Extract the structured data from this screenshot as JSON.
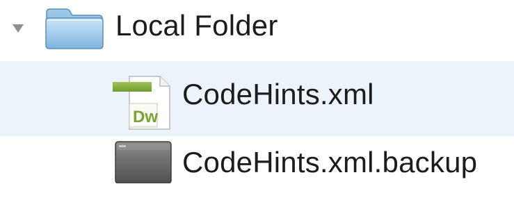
{
  "tree": {
    "folder": {
      "label": "Local Folder",
      "expanded": true,
      "disclosure_icon": "triangle-down-icon",
      "icon": "folder-icon"
    },
    "items": [
      {
        "label": "CodeHints.xml",
        "icon": "dreamweaver-file-icon",
        "icon_badge": "Dw",
        "selected": true
      },
      {
        "label": "CodeHints.xml.backup",
        "icon": "generic-file-icon",
        "selected": false
      }
    ]
  },
  "colors": {
    "selection_background": "#edf3fa",
    "annotation_arrow": "#ef8f8f",
    "dw_icon_accent": "#80a93a",
    "folder_blue": "#8dbfe3",
    "text": "#1c1c1c"
  }
}
